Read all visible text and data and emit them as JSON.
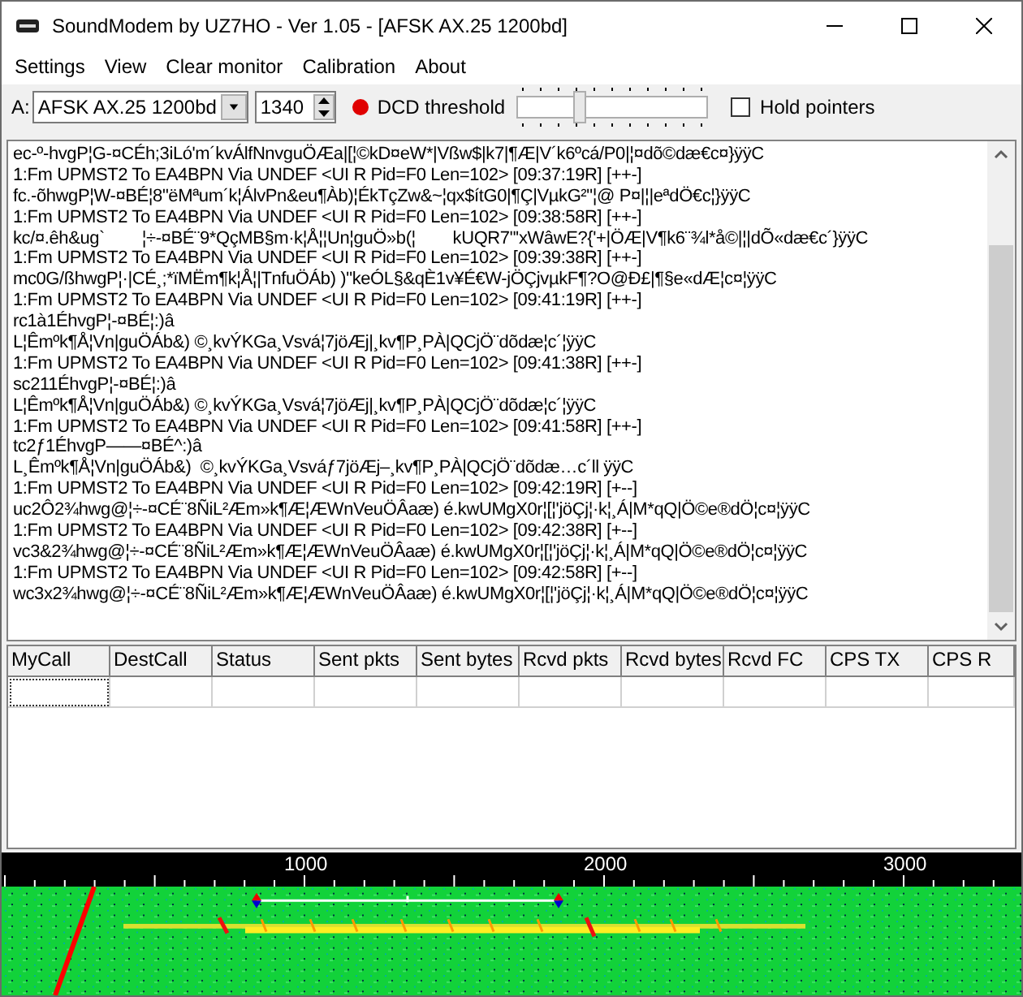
{
  "window": {
    "title": "SoundModem by UZ7HO - Ver 1.05 - [AFSK AX.25 1200bd]"
  },
  "menu": [
    "Settings",
    "View",
    "Clear monitor",
    "Calibration",
    "About"
  ],
  "toolbar": {
    "channel_label": "A:",
    "mode": "AFSK AX.25 1200bd",
    "frequency": "1340",
    "dcd": true,
    "dcd_label": "DCD threshold",
    "threshold": {
      "level": 0.32
    },
    "hold_pointers": {
      "label": "Hold pointers",
      "checked": false
    }
  },
  "monitor": {
    "lines": [
      "ec-º-hvgP¦G-¤CÉh;3iLó'm´kvÁlfNnvguÖÆa|[¦©kD¤eW*|Vßw$|k7|¶Æ|V´k6ºcá/P0|¦¤dõ©dæ€c¤}ÿÿC",
      "1:Fm UPMST2 To EA4BPN Via UNDEF <UI R Pid=F0 Len=102> [09:37:19R] [++-]",
      "fc.-õhwgP¦W-¤BÉ¦8\"ëMªum´k¦ÁlvPn&eu¶Àb)¦ÉkTçZw&~¦qx$ítG0|¶Ç|VµkG²\"¦@ P¤|¦|eªdÖ€c¦}ÿÿC",
      "1:Fm UPMST2 To EA4BPN Via UNDEF <UI R Pid=F0 Len=102> [09:38:58R] [++-]",
      "kc/¤.êh&ug`        ¦÷-¤BÉ¨9*QçMB§m·k¦Å¦¦Un¦guÖ»b(¦        kUQR7\"'xWâwE?{'+|ÖÆ|V¶k6¨¾l*å©|¦|dÕ«dæ€c´}ÿÿC",
      "1:Fm UPMST2 To EA4BPN Via UNDEF <UI R Pid=F0 Len=102> [09:39:38R] [++-]",
      "mc0G/ßhwgP¦·|CÉ¸;*ïMËm¶k¦Å¦|TnfuÖÁb) )\"keÓL§&qÈ1v¥É€W-jÖÇjvµkF¶?O@Ð£|¶§e«dÆ¦c¤¦ÿÿC",
      "1:Fm UPMST2 To EA4BPN Via UNDEF <UI R Pid=F0 Len=102> [09:41:19R] [++-]",
      "rc1à1ÉhvgP¦-¤BÉ¦:)â",
      "L¦Êmºk¶Å¦Vn|guÖÁb&) ©¸kvÝKGa¸Vsvá¦7jöÆj|¸kv¶P¸PÀ|QCjÖ¨dõdæ¦c´¦ÿÿC",
      "1:Fm UPMST2 To EA4BPN Via UNDEF <UI R Pid=F0 Len=102> [09:41:38R] [++-]",
      "sc211ÉhvgP¦-¤BÉ¦:)â",
      "L¦Êmºk¶Å¦Vn|guÖÁb&) ©¸kvÝKGa¸Vsvá¦7jöÆj|¸kv¶P¸PÀ|QCjÖ¨dõdæ¦c´¦ÿÿC",
      "1:Fm UPMST2 To EA4BPN Via UNDEF <UI R Pid=F0 Len=102> [09:41:58R] [++-]",
      "tc2ƒ1ÉhvgP——¤BÉ^:)â",
      "L¸Êmºk¶Å¦Vn|guÖÁb&)  ©¸kvÝKGa¸Vsváƒ7jöÆj–¸kv¶P¸PÀ|QCjÖ¨dõdæ…c´ll ÿÿC",
      "1:Fm UPMST2 To EA4BPN Via UNDEF <UI R Pid=F0 Len=102> [09:42:19R] [+--]",
      "uc2Ô2¾hwg@¦÷-¤CÉ¨8ÑiL²Æm»k¶Æ¦ÆWnVeuÖÂaæ) é.kwUMgX0r¦[¦'jöÇj¦·k¦¸Á|M*qQ|Ö©e®dÖ¦c¤¦ÿÿC",
      "1:Fm UPMST2 To EA4BPN Via UNDEF <UI R Pid=F0 Len=102> [09:42:38R] [+--]",
      "vc3&2¾hwg@¦÷-¤CÉ¨8ÑiL²Æm»k¶Æ¦ÆWnVeuÖÂaæ) é.kwUMgX0r¦[¦'jöÇj¦·k¦¸Á|M*qQ|Ö©e®dÖ¦c¤¦ÿÿC",
      "1:Fm UPMST2 To EA4BPN Via UNDEF <UI R Pid=F0 Len=102> [09:42:58R] [+--]",
      "wc3x2¾hwg@¦÷-¤CÉ¨8ÑiL²Æm»k¶Æ¦ÆWnVeuÖÂaæ) é.kwUMgX0r¦[¦'jöÇj¦·k¦¸Á|M*qQ|Ö©e®dÖ¦c¤¦ÿÿC"
    ]
  },
  "table": {
    "columns": [
      "MyCall",
      "DestCall",
      "Status",
      "Sent pkts",
      "Sent bytes",
      "Rcvd pkts",
      "Rcvd bytes",
      "Rcvd FC",
      "CPS TX",
      "CPS R"
    ]
  },
  "spectrum": {
    "scale_labels": [
      "1000",
      "2000",
      "3000"
    ]
  }
}
